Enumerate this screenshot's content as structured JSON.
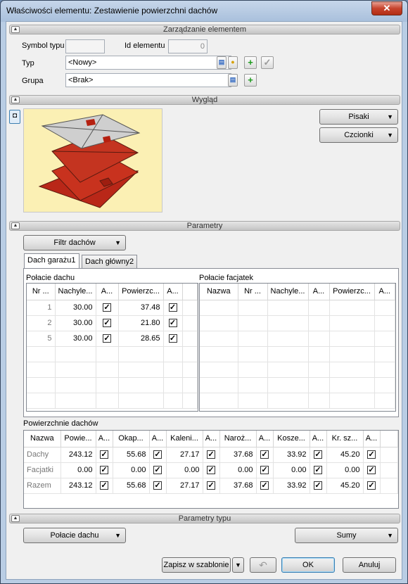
{
  "window": {
    "title": "Właściwości elementu: Zestawienie powierzchni dachów",
    "close_label": "✕"
  },
  "sections": {
    "element_management": "Zarządzanie elementem",
    "appearance": "Wygląd",
    "parameters": "Parametry",
    "type_parameters": "Parametry typu"
  },
  "management": {
    "symbol_label": "Symbol typu",
    "symbol_value": "",
    "id_label": "Id elementu",
    "id_value": "0",
    "type_label": "Typ",
    "type_value": "<Nowy>",
    "group_label": "Grupa",
    "group_value": "<Brak>"
  },
  "appearance": {
    "pens_button": "Pisaki",
    "fonts_button": "Czcionki"
  },
  "parameters": {
    "roof_filter_button": "Filtr dachów",
    "tabs": [
      "Dach garażu1",
      "Dach główny2"
    ],
    "roof_slopes_title": "Połacie dachu",
    "roof_slopes_columns": [
      "Nr ...",
      "Nachyle...",
      "A...",
      "Powierzc...",
      "A..."
    ],
    "roof_slopes_rows": [
      {
        "nr": "1",
        "slope": "30.00",
        "area": "37.48"
      },
      {
        "nr": "2",
        "slope": "30.00",
        "area": "21.80"
      },
      {
        "nr": "5",
        "slope": "30.00",
        "area": "28.65"
      }
    ],
    "dormer_title": "Połacie facjatek",
    "dormer_columns": [
      "Nazwa",
      "Nr ...",
      "Nachyle...",
      "A...",
      "Powierzc...",
      "A..."
    ],
    "surfaces_title": "Powierzchnie dachów",
    "surfaces_columns": [
      "Nazwa",
      "Powie...",
      "A...",
      "Okap...",
      "A...",
      "Kaleni...",
      "A...",
      "Naroż...",
      "A...",
      "Kosze...",
      "A...",
      "Kr. sz...",
      "A..."
    ],
    "surfaces_rows": [
      {
        "name": "Dachy",
        "values": [
          "243.12",
          "55.68",
          "27.17",
          "37.68",
          "33.92",
          "45.20"
        ]
      },
      {
        "name": "Facjatki",
        "values": [
          "0.00",
          "0.00",
          "0.00",
          "0.00",
          "0.00",
          "0.00"
        ]
      },
      {
        "name": "Razem",
        "values": [
          "243.12",
          "55.68",
          "27.17",
          "37.68",
          "33.92",
          "45.20"
        ]
      }
    ]
  },
  "type_parameters": {
    "left_dropdown": "Połacie dachu",
    "right_dropdown": "Sumy"
  },
  "footer": {
    "save_template_button": "Zapisz w szablonie",
    "ok_button": "OK",
    "cancel_button": "Anuluj"
  },
  "colors": {
    "preview_background": "#fbf0b4",
    "roof_red": "#c8321e",
    "roof_gray": "#c8c8c8"
  }
}
